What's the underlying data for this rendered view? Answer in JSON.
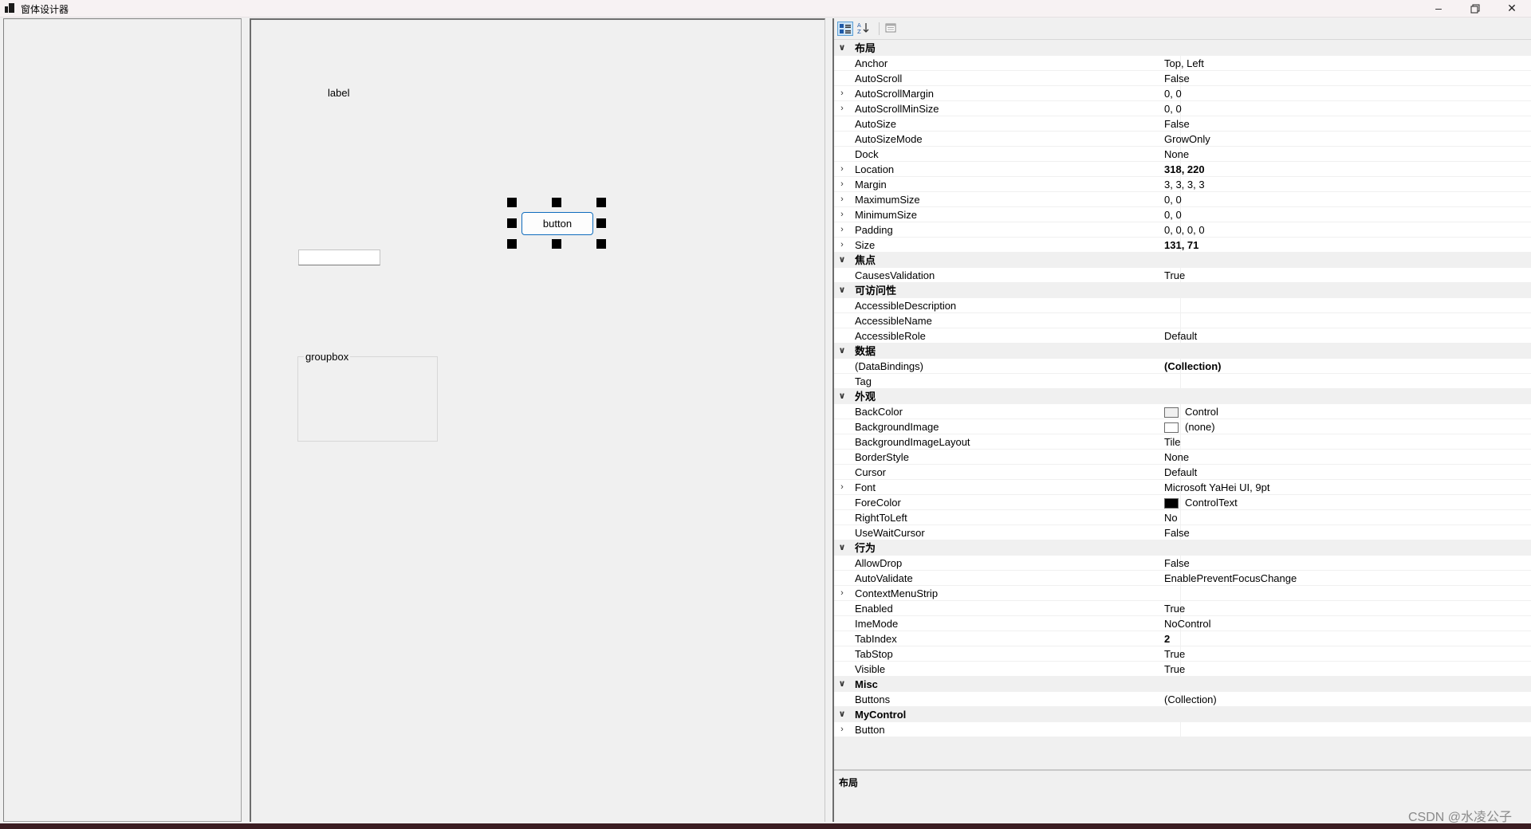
{
  "window": {
    "title": "窗体设计器"
  },
  "controls": {
    "label_text": "label",
    "button_text": "button",
    "groupbox_text": "groupbox"
  },
  "property_rows": [
    {
      "type": "cat",
      "name": "布局"
    },
    {
      "name": "Anchor",
      "value": "Top, Left"
    },
    {
      "name": "AutoScroll",
      "value": "False"
    },
    {
      "name": "AutoScrollMargin",
      "value": "0, 0",
      "expand": true
    },
    {
      "name": "AutoScrollMinSize",
      "value": "0, 0",
      "expand": true
    },
    {
      "name": "AutoSize",
      "value": "False"
    },
    {
      "name": "AutoSizeMode",
      "value": "GrowOnly"
    },
    {
      "name": "Dock",
      "value": "None"
    },
    {
      "name": "Location",
      "value": "318, 220",
      "expand": true,
      "bold": true
    },
    {
      "name": "Margin",
      "value": "3, 3, 3, 3",
      "expand": true
    },
    {
      "name": "MaximumSize",
      "value": "0, 0",
      "expand": true
    },
    {
      "name": "MinimumSize",
      "value": "0, 0",
      "expand": true
    },
    {
      "name": "Padding",
      "value": "0, 0, 0, 0",
      "expand": true
    },
    {
      "name": "Size",
      "value": "131, 71",
      "expand": true,
      "bold": true
    },
    {
      "type": "cat",
      "name": "焦点"
    },
    {
      "name": "CausesValidation",
      "value": "True"
    },
    {
      "type": "cat",
      "name": "可访问性"
    },
    {
      "name": "AccessibleDescription",
      "value": ""
    },
    {
      "name": "AccessibleName",
      "value": ""
    },
    {
      "name": "AccessibleRole",
      "value": "Default"
    },
    {
      "type": "cat",
      "name": "数据"
    },
    {
      "name": "(DataBindings)",
      "value": "(Collection)",
      "bold": true
    },
    {
      "name": "Tag",
      "value": ""
    },
    {
      "type": "cat",
      "name": "外观"
    },
    {
      "name": "BackColor",
      "value": "Control",
      "swatch": "#f0f0f0"
    },
    {
      "name": "BackgroundImage",
      "value": "(none)",
      "swatch": "#ffffff"
    },
    {
      "name": "BackgroundImageLayout",
      "value": "Tile"
    },
    {
      "name": "BorderStyle",
      "value": "None"
    },
    {
      "name": "Cursor",
      "value": "Default"
    },
    {
      "name": "Font",
      "value": "Microsoft YaHei UI, 9pt",
      "expand": true
    },
    {
      "name": "ForeColor",
      "value": "ControlText",
      "swatch": "#000000"
    },
    {
      "name": "RightToLeft",
      "value": "No"
    },
    {
      "name": "UseWaitCursor",
      "value": "False"
    },
    {
      "type": "cat",
      "name": "行为"
    },
    {
      "name": "AllowDrop",
      "value": "False"
    },
    {
      "name": "AutoValidate",
      "value": "EnablePreventFocusChange"
    },
    {
      "name": "ContextMenuStrip",
      "value": "",
      "expand": true
    },
    {
      "name": "Enabled",
      "value": "True"
    },
    {
      "name": "ImeMode",
      "value": "NoControl"
    },
    {
      "name": "TabIndex",
      "value": "2",
      "bold": true
    },
    {
      "name": "TabStop",
      "value": "True"
    },
    {
      "name": "Visible",
      "value": "True"
    },
    {
      "type": "cat",
      "name": "Misc"
    },
    {
      "name": "Buttons",
      "value": "(Collection)"
    },
    {
      "type": "cat",
      "name": "MyControl"
    },
    {
      "name": "Button",
      "value": "",
      "expand": true
    }
  ],
  "description": {
    "title": "布局"
  },
  "watermark": "CSDN @水凌公子",
  "icons": {
    "app": "form-designer-icon",
    "minimize": "minimize-icon",
    "restore": "restore-icon",
    "close": "close-icon",
    "categorized": "categorized-view-icon",
    "alphabetical": "alphabetical-sort-icon",
    "property_pages": "property-pages-icon"
  }
}
